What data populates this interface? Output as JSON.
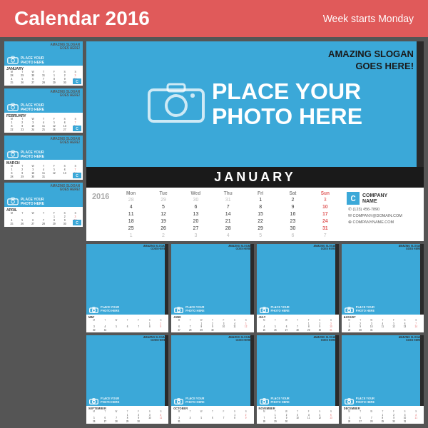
{
  "header": {
    "title": "Calendar 2016",
    "subtitle": "Week starts Monday"
  },
  "featured": {
    "slogan_line1": "AMAZING SLOGAN",
    "slogan_line2": "GOES HERE!",
    "photo_line1": "PLACE YOUR",
    "photo_line2": "PHOTO HERE",
    "month": "JANUARY",
    "year": "2016"
  },
  "company": {
    "logo_letter": "C",
    "name_line1": "COMPANY",
    "name_line2": "NAME",
    "phone": "✆ (123) 456-7890",
    "email": "✉ COMPANY@DOMAIN.COM",
    "website": "⊕ COMPANYNAME.COM"
  },
  "left_months": [
    {
      "name": "FEBRUARY",
      "slogan": "AMAZING SLOGAN\nGOES HERE!"
    },
    {
      "name": "MARCH",
      "slogan": "AMAZING SLOGAN\nGOES HERE!"
    },
    {
      "name": "APRIL",
      "slogan": "AMAZING SLOGAN\nGOES HERE!"
    }
  ],
  "bottom_row1": [
    {
      "name": "MAY"
    },
    {
      "name": "JUNE"
    },
    {
      "name": "JULY"
    },
    {
      "name": "AUGUST"
    }
  ],
  "bottom_row2": [
    {
      "name": "SEPTEMBER"
    },
    {
      "name": "OCTOBER"
    },
    {
      "name": "NOVEMBER"
    },
    {
      "name": "DECEMBER"
    }
  ],
  "january_days": {
    "headers": [
      "Mon",
      "Tue",
      "Wed",
      "Thu",
      "Fri",
      "Sat",
      "Sun"
    ],
    "week1": [
      "28",
      "29",
      "30",
      "31",
      "1",
      "2",
      "3"
    ],
    "week2": [
      "4",
      "5",
      "6",
      "7",
      "8",
      "9",
      "10"
    ],
    "week3": [
      "11",
      "12",
      "13",
      "14",
      "15",
      "16",
      "17"
    ],
    "week4": [
      "18",
      "19",
      "20",
      "21",
      "22",
      "23",
      "24"
    ],
    "week5": [
      "25",
      "26",
      "27",
      "28",
      "29",
      "30",
      "31"
    ],
    "week6": [
      "1",
      "2",
      "3",
      "4",
      "5",
      "6",
      "7"
    ]
  }
}
